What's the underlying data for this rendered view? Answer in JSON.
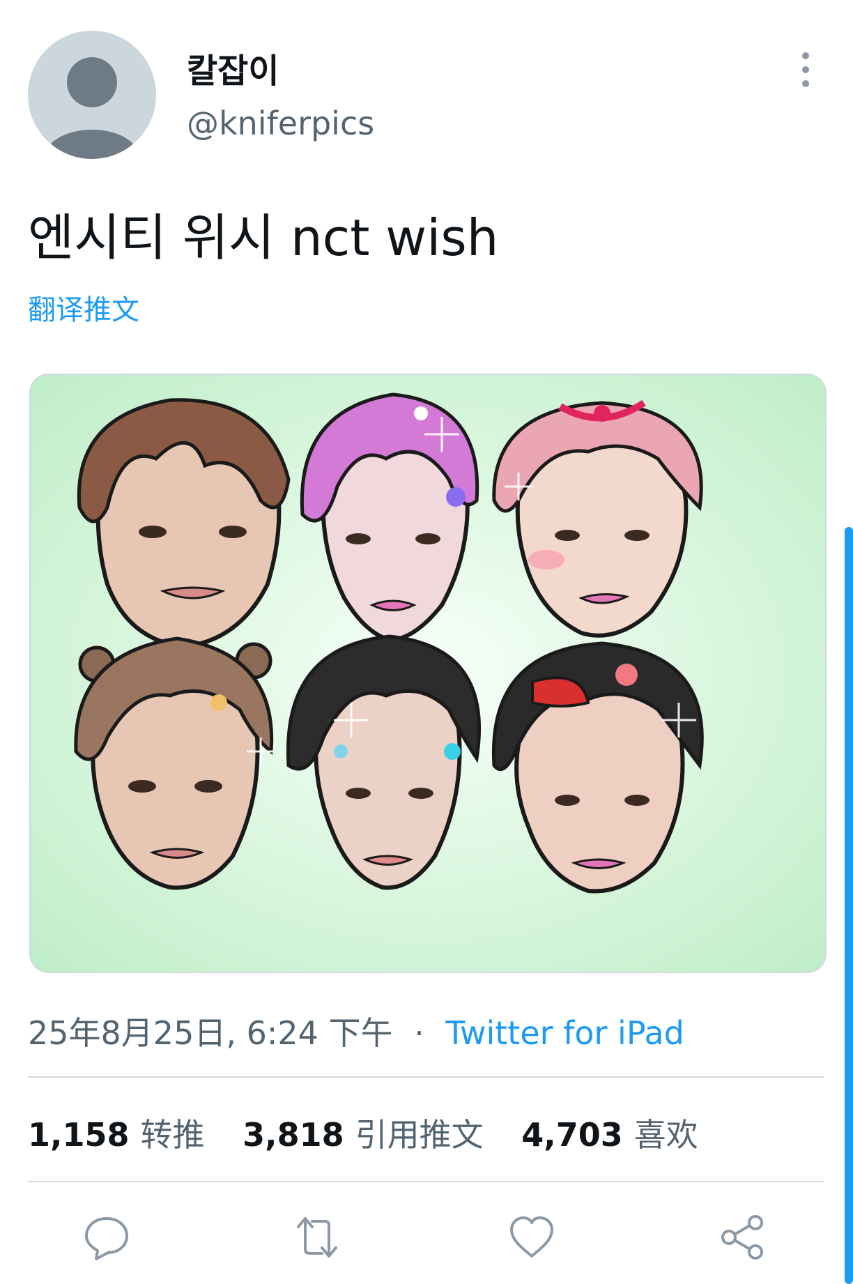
{
  "user": {
    "display_name": "칼잡이",
    "handle": "@kniferpics",
    "avatar_icon": "default-avatar-icon"
  },
  "tweet": {
    "text": "엔시티 위시 nct wish",
    "translate_label": "翻译推文",
    "image_icon": "portrait-illustration-six-faces",
    "timestamp": "25年8月25日, 6:24 下午",
    "separator": "·",
    "source": "Twitter for iPad"
  },
  "stats": {
    "retweets_count": "1,158",
    "retweets_label": "转推",
    "quotes_count": "3,818",
    "quotes_label": "引用推文",
    "likes_count": "4,703",
    "likes_label": "喜欢"
  },
  "actions": [
    "reply-icon",
    "retweet-icon",
    "like-icon",
    "share-icon"
  ],
  "colors": {
    "accent": "#1d9bf0",
    "secondary_text": "#536471",
    "image_background": "#d8f6dd"
  }
}
